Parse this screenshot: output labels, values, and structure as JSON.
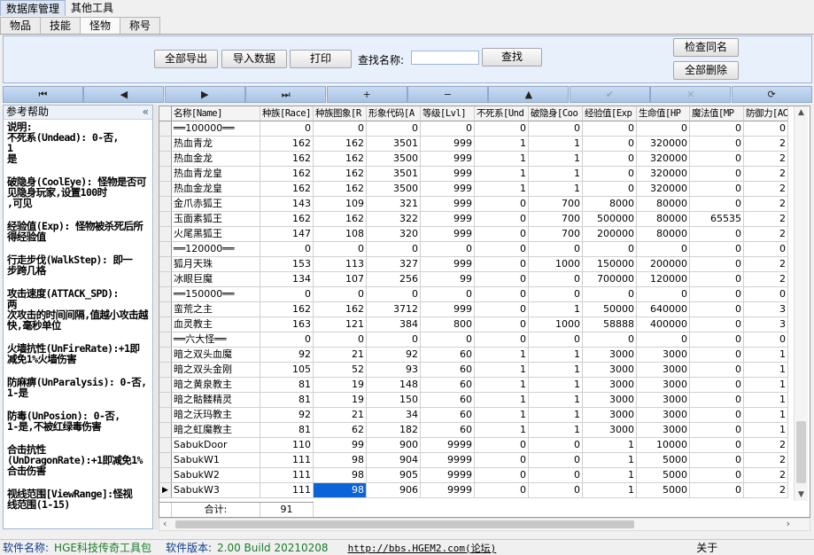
{
  "menu": [
    "数据库管理",
    "其他工具"
  ],
  "tabs": [
    "物品",
    "技能",
    "怪物",
    "称号"
  ],
  "toolbar": {
    "export_all": "全部导出",
    "import": "导入数据",
    "print": "打印",
    "search_label": "查找名称:",
    "search_value": "",
    "search_button": "查找",
    "check_dup": "检查同名",
    "delete_all": "全部删除"
  },
  "navigator": {
    "first": "⏮",
    "prior": "◀",
    "next": "▶",
    "last": "⏭",
    "insert": "+",
    "delete": "−",
    "edit": "▲",
    "post": "✔",
    "cancel": "✕",
    "refresh": "⟳"
  },
  "help": {
    "title": "参考帮助",
    "collapse": "«",
    "paragraphs": [
      "说明:\n不死系(Undead): 0-否,\n1\n是",
      "破隐身(CoolEye): 怪物是否可见隐身玩家,设置100时\n,可见",
      "经验值(Exp): 怪物被杀死后所得经验值",
      "行走步伐(WalkStep): 即一\n步跨几格",
      "攻击速度(ATTACK_SPD):\n两\n次攻击的时间间隔,值越小攻击越快,毫秒单位",
      "火墙抗性(UnFireRate):+1即减免1%火墙伤害",
      "防麻痹(UnParalysis): 0-否, 1-是",
      "防毒(UnPosion): 0-否,\n1-是,不被红绿毒伤害",
      "合击抗性\n(UnDragonRate):+1即减免1%合击伤害",
      "视线范围[ViewRange]:怪视\n线范围(1-15)"
    ]
  },
  "grid": {
    "columns": [
      "名称[Name]",
      "种族[Race]",
      "种族图象[R",
      "形象代码[A",
      "等级[Lvl]",
      "不死系[Und",
      "破隐身[Coo",
      "经验值[Exp",
      "生命值[HP",
      "魔法值[MP",
      "防御力[AC"
    ],
    "rows": [
      [
        "══100000══",
        "0",
        "0",
        "0",
        "0",
        "0",
        "0",
        "0",
        "0",
        "0",
        "0"
      ],
      [
        "热血青龙",
        "162",
        "162",
        "3501",
        "999",
        "1",
        "1",
        "0",
        "320000",
        "0",
        "2"
      ],
      [
        "热血金龙",
        "162",
        "162",
        "3500",
        "999",
        "1",
        "1",
        "0",
        "320000",
        "0",
        "2"
      ],
      [
        "热血青龙皇",
        "162",
        "162",
        "3501",
        "999",
        "1",
        "1",
        "0",
        "320000",
        "0",
        "2"
      ],
      [
        "热血金龙皇",
        "162",
        "162",
        "3500",
        "999",
        "1",
        "1",
        "0",
        "320000",
        "0",
        "2"
      ],
      [
        "金爪赤狐王",
        "143",
        "109",
        "321",
        "999",
        "0",
        "700",
        "8000",
        "80000",
        "0",
        "2"
      ],
      [
        "玉面素狐王",
        "162",
        "162",
        "322",
        "999",
        "0",
        "700",
        "500000",
        "80000",
        "65535",
        "2"
      ],
      [
        "火尾黑狐王",
        "147",
        "108",
        "320",
        "999",
        "0",
        "700",
        "200000",
        "80000",
        "0",
        "2"
      ],
      [
        "══120000══",
        "0",
        "0",
        "0",
        "0",
        "0",
        "0",
        "0",
        "0",
        "0",
        "0"
      ],
      [
        "狐月天珠",
        "153",
        "113",
        "327",
        "999",
        "0",
        "1000",
        "150000",
        "200000",
        "0",
        "2"
      ],
      [
        "冰眼巨魔",
        "134",
        "107",
        "256",
        "99",
        "0",
        "0",
        "700000",
        "120000",
        "0",
        "2"
      ],
      [
        "══150000══",
        "0",
        "0",
        "0",
        "0",
        "0",
        "0",
        "0",
        "0",
        "0",
        "0"
      ],
      [
        "蛮荒之主",
        "162",
        "162",
        "3712",
        "999",
        "0",
        "1",
        "50000",
        "640000",
        "0",
        "3"
      ],
      [
        "血灵教主",
        "163",
        "121",
        "384",
        "800",
        "0",
        "1000",
        "58888",
        "400000",
        "0",
        "3"
      ],
      [
        "══六大怪══",
        "0",
        "0",
        "0",
        "0",
        "0",
        "0",
        "0",
        "0",
        "0",
        "0"
      ],
      [
        "暗之双头血魔",
        "92",
        "21",
        "92",
        "60",
        "1",
        "1",
        "3000",
        "3000",
        "0",
        "1"
      ],
      [
        "暗之双头金刚",
        "105",
        "52",
        "93",
        "60",
        "1",
        "1",
        "3000",
        "3000",
        "0",
        "1"
      ],
      [
        "暗之黄泉教主",
        "81",
        "19",
        "148",
        "60",
        "1",
        "1",
        "3000",
        "3000",
        "0",
        "1"
      ],
      [
        "暗之骷髅精灵",
        "81",
        "19",
        "150",
        "60",
        "1",
        "1",
        "3000",
        "3000",
        "0",
        "1"
      ],
      [
        "暗之沃玛教主",
        "92",
        "21",
        "34",
        "60",
        "1",
        "1",
        "3000",
        "3000",
        "0",
        "1"
      ],
      [
        "暗之虹魔教主",
        "81",
        "62",
        "182",
        "60",
        "1",
        "1",
        "3000",
        "3000",
        "0",
        "1"
      ],
      [
        "SabukDoor",
        "110",
        "99",
        "900",
        "9999",
        "0",
        "0",
        "1",
        "10000",
        "0",
        "2"
      ],
      [
        "SabukW1",
        "111",
        "98",
        "904",
        "9999",
        "0",
        "0",
        "1",
        "5000",
        "0",
        "2"
      ],
      [
        "SabukW2",
        "111",
        "98",
        "905",
        "9999",
        "0",
        "0",
        "1",
        "5000",
        "0",
        "2"
      ],
      [
        "SabukW3",
        "111",
        "98",
        "906",
        "9999",
        "0",
        "0",
        "1",
        "5000",
        "0",
        "2"
      ]
    ],
    "current_row_marker": "▶",
    "footer_label": "合计:",
    "footer_count": "91"
  },
  "status": {
    "name_label": "软件名称:",
    "name_value": "HGE科技传奇工具包",
    "version_label": "软件版本:",
    "version_value": "2.00 Build 20210208",
    "url": "http://bbs.HGEM2.com(论坛)",
    "about": "关于"
  }
}
